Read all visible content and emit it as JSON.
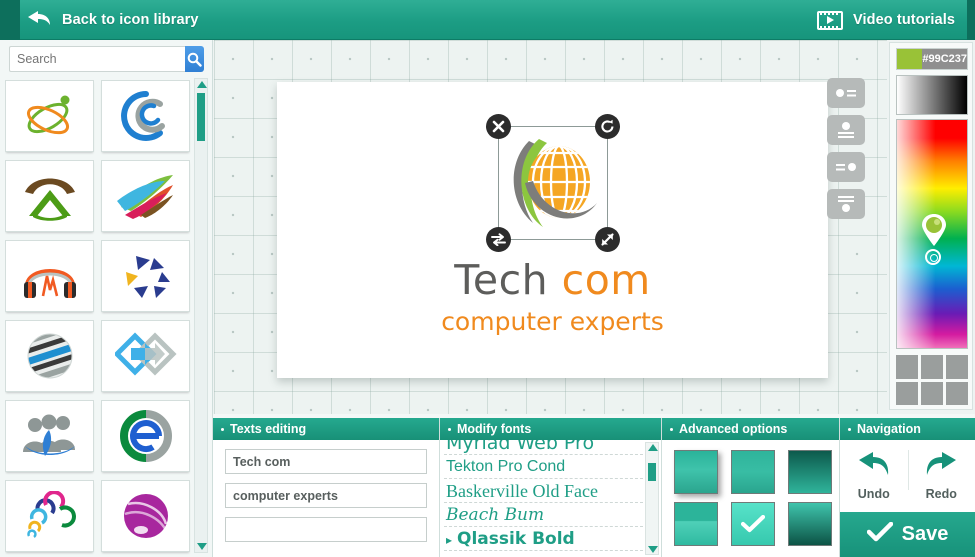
{
  "header": {
    "back_label": "Back to icon library",
    "back_icon": "back-arrow-icon",
    "video_label": "Video tutorials",
    "video_icon": "film-strip-play-icon",
    "bg_color": "#1c9d84"
  },
  "sidebar": {
    "search": {
      "placeholder": "Search",
      "value": "",
      "button_icon": "search-icon"
    },
    "icons": [
      {
        "name": "atom-orbit-logo",
        "colors": [
          "#6cb22e",
          "#f08a1e"
        ]
      },
      {
        "name": "circular-arrow-c-logo",
        "colors": [
          "#1f7fd0",
          "#9aa3a1"
        ]
      },
      {
        "name": "mountain-arrow-logo",
        "colors": [
          "#6b4a21",
          "#4c9c16"
        ]
      },
      {
        "name": "colored-wings-logo",
        "colors": [
          "#7dbf3e",
          "#3fb6e0",
          "#e03c2c",
          "#d81e5b"
        ]
      },
      {
        "name": "headphones-wave-logo",
        "colors": [
          "#f15a22",
          "#2b2b2b"
        ]
      },
      {
        "name": "triangle-star-logo",
        "colors": [
          "#2a3c8f",
          "#f0b41e"
        ]
      },
      {
        "name": "striped-globe-logo",
        "colors": [
          "#9aa3a1",
          "#1f8fd0",
          "#3a3a3a"
        ]
      },
      {
        "name": "diamond-arrows-logo",
        "colors": [
          "#3fb0e8",
          "#b9c3c1"
        ]
      },
      {
        "name": "people-group-logo",
        "colors": [
          "#8e9796",
          "#2f7fd4"
        ]
      },
      {
        "name": "letter-e-circle-logo",
        "colors": [
          "#0b8a3d",
          "#1f5fd0",
          "#9aa3a1"
        ]
      },
      {
        "name": "swirl-petals-logo",
        "colors": [
          "#e0268c",
          "#0b8a3d",
          "#2a3c8f",
          "#3fb6e0"
        ]
      },
      {
        "name": "purple-sphere-logo",
        "colors": [
          "#a8279e"
        ]
      }
    ],
    "scroll_up_icon": "scroll-up-arrow-icon",
    "scroll_down_icon": "scroll-down-arrow-icon"
  },
  "canvas": {
    "logo": {
      "icon_name": "orange-globe-green-swoosh-logo",
      "title_part1": "Tech",
      "title_part2": "com",
      "title_part1_color": "#5d5d5b",
      "title_part2_color": "#f08a1e",
      "subtitle": "computer experts",
      "subtitle_color": "#f08a1e"
    },
    "handles": [
      {
        "name": "delete-handle",
        "icon": "close-x-icon"
      },
      {
        "name": "rotate-handle",
        "icon": "rotate-icon"
      },
      {
        "name": "flip-handle",
        "icon": "horizontal-swap-icon"
      },
      {
        "name": "resize-handle",
        "icon": "diagonal-resize-icon"
      }
    ],
    "tools": [
      {
        "name": "layout-icon-left-button",
        "icon": "icon-left-text-right"
      },
      {
        "name": "layout-icon-top-button",
        "icon": "icon-top-text-below"
      },
      {
        "name": "layout-icon-right-button",
        "icon": "text-left-icon-right"
      },
      {
        "name": "layout-icon-bottom-button",
        "icon": "text-above-icon-bottom"
      }
    ]
  },
  "color_picker": {
    "hex": "#99C237",
    "swatch_color": "#99C237",
    "marker_icon": "color-pin-marker",
    "presets": [
      "#9a9e9d",
      "#9a9e9d",
      "#9a9e9d",
      "#9a9e9d",
      "#9a9e9d",
      "#9a9e9d"
    ]
  },
  "panels": {
    "texts": {
      "title": "Texts editing",
      "inputs": [
        {
          "name": "logo-title-input",
          "value": "Tech com"
        },
        {
          "name": "logo-subtitle-input",
          "value": "computer experts"
        },
        {
          "name": "logo-tagline-input",
          "value": ""
        }
      ]
    },
    "fonts": {
      "title": "Modify fonts",
      "items": [
        {
          "label": "Myriad Web Pro",
          "selected": false
        },
        {
          "label": "Tekton Pro Cond",
          "selected": false
        },
        {
          "label": "Baskerville Old Face",
          "selected": false
        },
        {
          "label": "Beach Bum",
          "selected": false
        },
        {
          "label": "Qlassik Bold",
          "selected": true
        }
      ]
    },
    "advanced": {
      "title": "Advanced options",
      "styles": [
        {
          "name": "style-shadow",
          "selected": false
        },
        {
          "name": "style-flat",
          "selected": false
        },
        {
          "name": "style-dark-to-light",
          "selected": false
        },
        {
          "name": "style-split-gloss",
          "selected": false
        },
        {
          "name": "style-light-gloss",
          "selected": true
        },
        {
          "name": "style-light-to-dark",
          "selected": false
        }
      ],
      "check_icon": "checkmark-icon"
    },
    "navigation": {
      "title": "Navigation",
      "undo_label": "Undo",
      "undo_icon": "undo-arrow-icon",
      "redo_label": "Redo",
      "redo_icon": "redo-arrow-icon",
      "save_label": "Save",
      "save_icon": "checkmark-icon"
    }
  }
}
